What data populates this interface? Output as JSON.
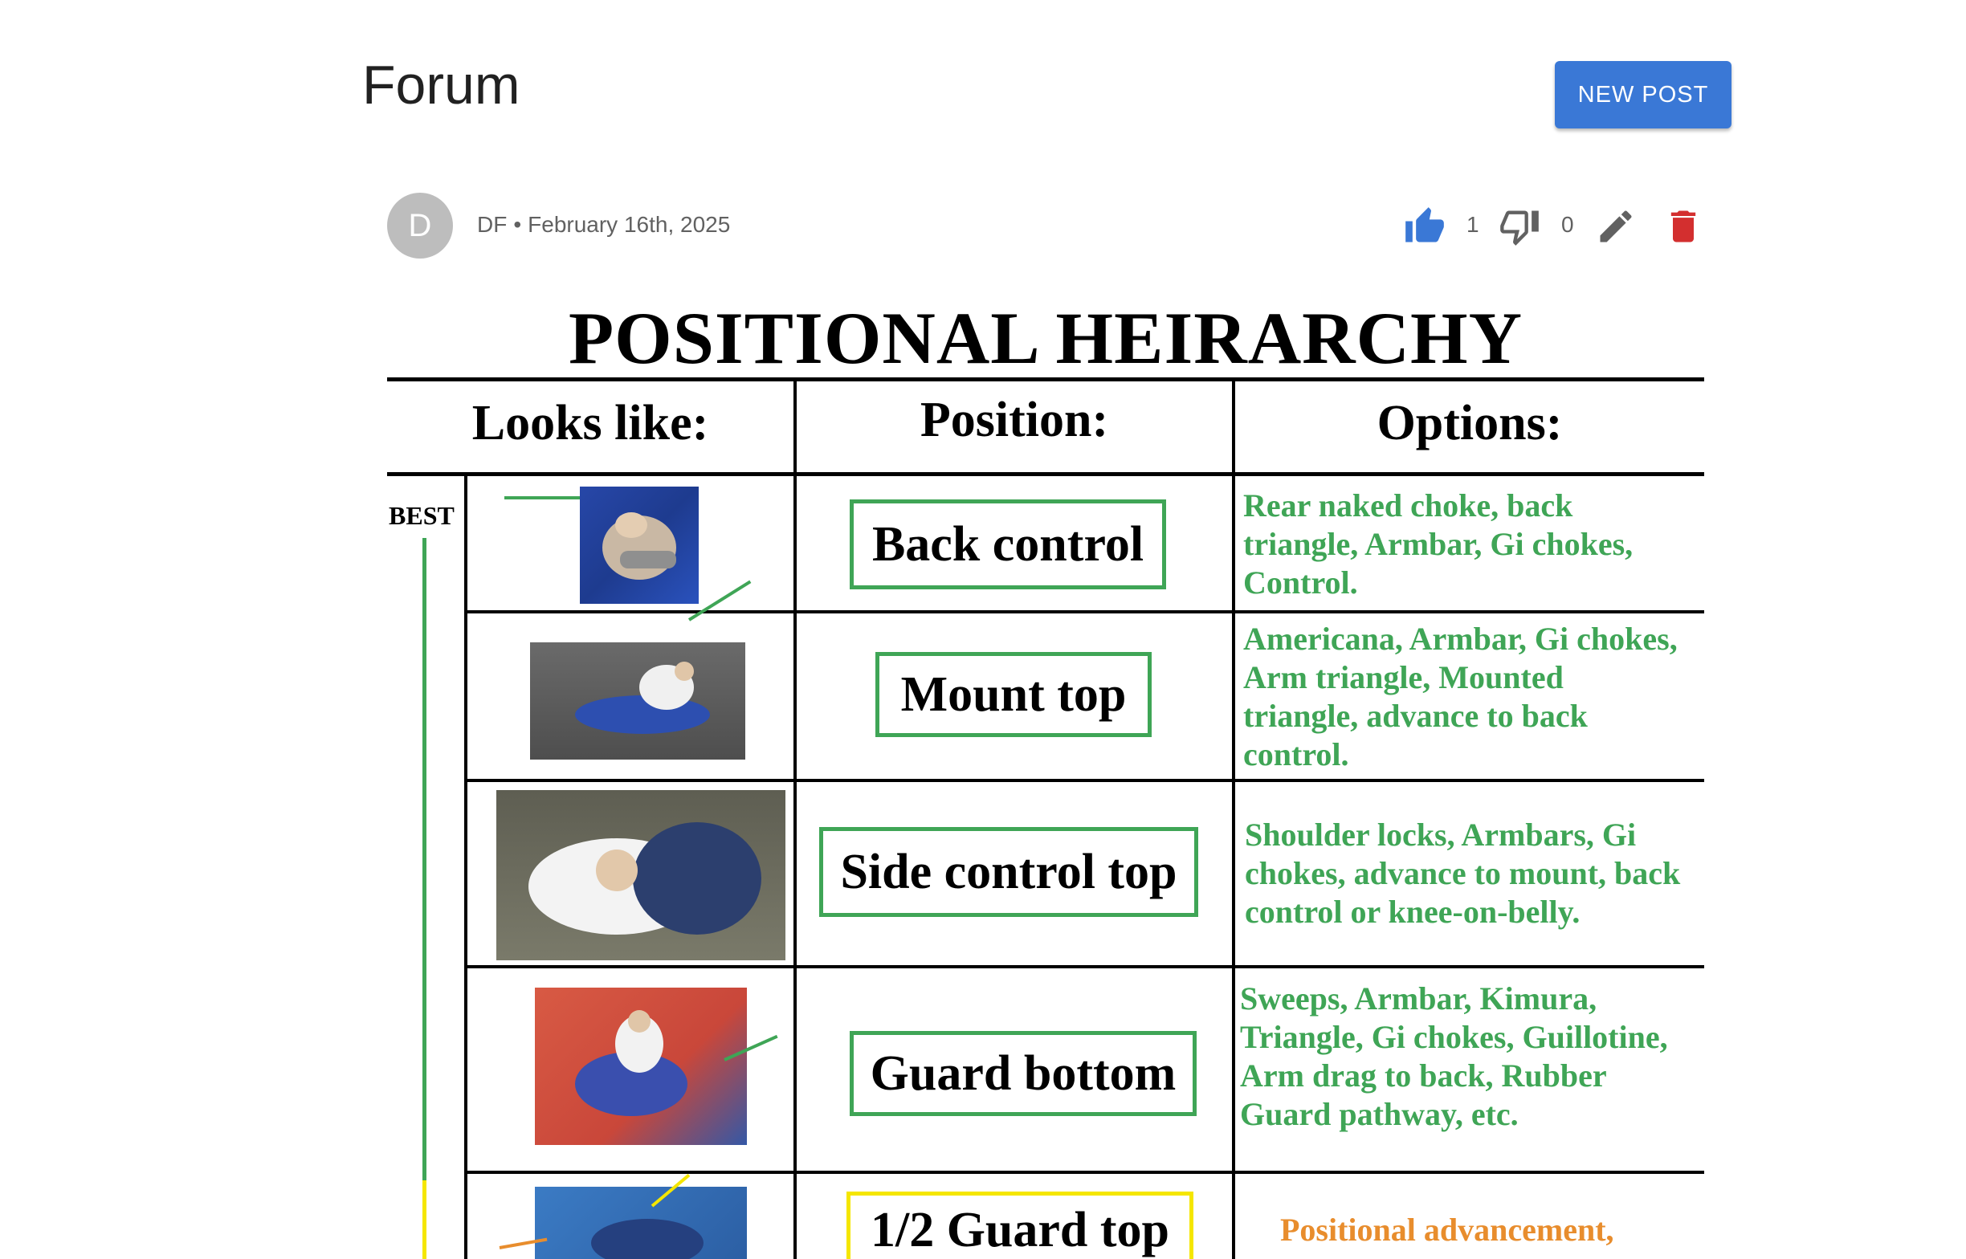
{
  "page": {
    "title": "Forum",
    "new_post_label": "NEW POST"
  },
  "post": {
    "avatar_initial": "D",
    "author": "DF",
    "separator": "•",
    "date": "February 16th, 2025",
    "likes": "1",
    "dislikes": "0",
    "icons": {
      "like": "thumb-up-icon",
      "dislike": "thumb-down-icon",
      "edit": "pencil-icon",
      "delete": "trash-icon"
    },
    "colors": {
      "like": "#3a78d6",
      "delete": "#d32f2f",
      "accent": "#3a78d6"
    }
  },
  "figure": {
    "title": "POSITIONAL HEIRARCHY",
    "headers": [
      "Looks like:",
      "Position:",
      "Options:"
    ],
    "best_label": "BEST",
    "rows": [
      {
        "position": "Back control",
        "options": [
          "Rear naked choke, back",
          "triangle, Armbar, Gi chokes,",
          "Control."
        ]
      },
      {
        "position": "Mount top",
        "options": [
          "Americana, Armbar, Gi chokes,",
          "Arm triangle, Mounted",
          "triangle, advance to back",
          "control."
        ]
      },
      {
        "position": "Side control top",
        "options": [
          "Shoulder locks, Armbars, Gi",
          "chokes, advance to mount, back",
          "control or knee-on-belly."
        ]
      },
      {
        "position": "Guard bottom",
        "options": [
          "Sweeps, Armbar, Kimura,",
          "Triangle, Gi chokes, Guillotine,",
          "Arm drag to back, Rubber",
          "Guard pathway, etc."
        ]
      },
      {
        "position": "1/2 Guard top",
        "options": [
          "Positional advancement,"
        ]
      }
    ],
    "colors": {
      "green": "#3fa556",
      "yellow": "#f5e600",
      "orange": "#e88d2d"
    }
  }
}
